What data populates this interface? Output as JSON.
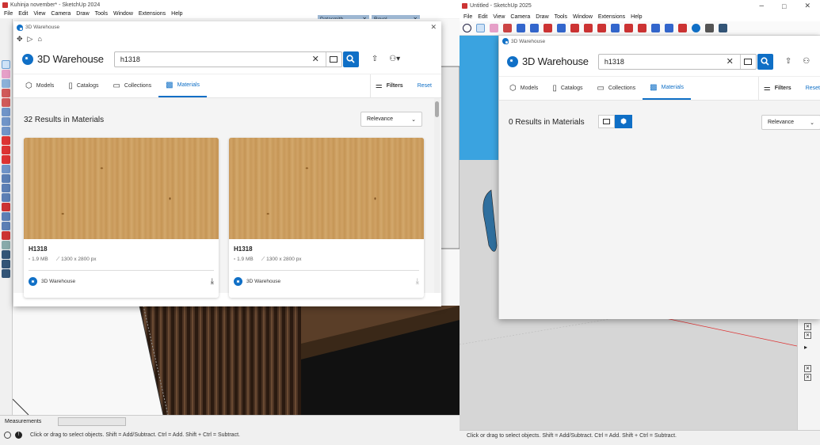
{
  "left_window": {
    "title": "Kuhinja november* - SketchUp 2024",
    "menu": [
      "File",
      "Edit",
      "View",
      "Camera",
      "Draw",
      "Tools",
      "Window",
      "Extensions",
      "Help"
    ],
    "panels": [
      "Datasmith",
      "Revel"
    ],
    "measurements_label": "Measurements",
    "status": "Click or drag to select objects. Shift = Add/Subtract. Ctrl = Add. Shift + Ctrl = Subtract."
  },
  "left_warehouse": {
    "title": "3D Warehouse",
    "brand": "3D Warehouse",
    "search_value": "h1318",
    "tabs": [
      "Models",
      "Catalogs",
      "Collections",
      "Materials"
    ],
    "active_tab": "Materials",
    "filters": "Filters",
    "reset": "Reset",
    "results": "32 Results in Materials",
    "sort": "Relevance",
    "cards": [
      {
        "name": "H1318",
        "size": "1.9 MB",
        "dims": "1300 x 2800 px",
        "publisher": "3D Warehouse"
      },
      {
        "name": "H1318",
        "size": "1.9 MB",
        "dims": "1300 x 2800 px",
        "publisher": "3D Warehouse"
      }
    ]
  },
  "right_window": {
    "title": "Untitled - SketchUp 2025",
    "menu": [
      "File",
      "Edit",
      "View",
      "Camera",
      "Draw",
      "Tools",
      "Window",
      "Extensions",
      "Help"
    ],
    "status": "Click or drag to select objects. Shift = Add/Subtract. Ctrl = Add. Shift + Ctrl = Subtract."
  },
  "right_warehouse": {
    "title": "3D Warehouse",
    "brand": "3D Warehouse",
    "search_value": "h1318",
    "tabs": [
      "Models",
      "Catalogs",
      "Collections",
      "Materials"
    ],
    "active_tab": "Materials",
    "filters": "Filters",
    "reset": "Reset",
    "results": "0 Results in Materials",
    "sort": "Relevance"
  },
  "colors": {
    "accent": "#0f6fc6",
    "wood": "#c99a5c"
  }
}
